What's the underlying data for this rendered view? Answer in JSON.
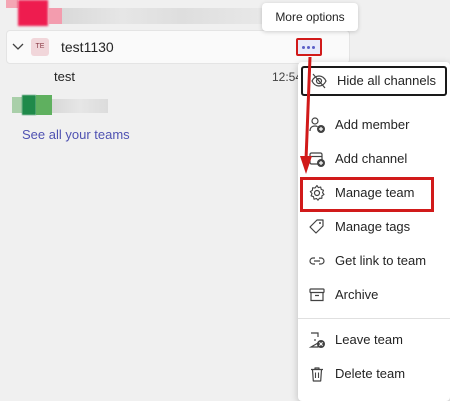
{
  "tooltip": {
    "text": "More options"
  },
  "team": {
    "avatar_initials": "TE",
    "name": "test1130",
    "channel": {
      "name": "test",
      "time": "12:54"
    }
  },
  "see_all_label": "See all your teams",
  "menu": {
    "items": [
      {
        "label": "Hide all channels",
        "icon": "eye-off-icon"
      },
      {
        "label": "Add member",
        "icon": "person-add-icon"
      },
      {
        "label": "Add channel",
        "icon": "channel-add-icon"
      },
      {
        "label": "Manage team",
        "icon": "gear-icon"
      },
      {
        "label": "Manage tags",
        "icon": "tag-icon"
      },
      {
        "label": "Get link to team",
        "icon": "link-icon"
      },
      {
        "label": "Archive",
        "icon": "archive-icon"
      },
      {
        "label": "Leave team",
        "icon": "leave-team-icon"
      },
      {
        "label": "Delete team",
        "icon": "trash-icon"
      }
    ]
  },
  "colors": {
    "accent": "#5b5fc7",
    "annotation_red": "#d11a1a",
    "link": "#4f52b2"
  }
}
